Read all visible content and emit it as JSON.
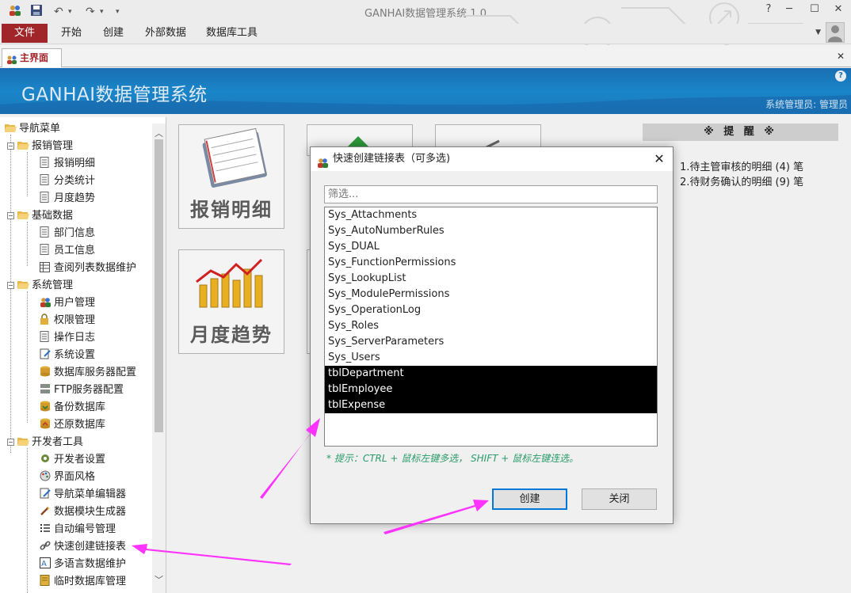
{
  "window": {
    "title": "GANHAI数据管理系统 1.0",
    "help": "?",
    "minimize": "─",
    "maximize": "☐",
    "close": "✕"
  },
  "quick_access": {
    "undo": "↶",
    "redo": "↷",
    "dropdown": "▾"
  },
  "menu": {
    "file": "文件",
    "items": [
      "开始",
      "创建",
      "外部数据",
      "数据库工具"
    ]
  },
  "tab": {
    "label": "主界面",
    "close": "✕"
  },
  "banner": {
    "app_name": "GANHAI数据管理系统",
    "user_label": "系统管理员: 管理员",
    "help": "?"
  },
  "nav": {
    "root": "导航菜单",
    "groups": [
      {
        "label": "报销管理",
        "items": [
          "报销明细",
          "分类统计",
          "月度趋势"
        ]
      },
      {
        "label": "基础数据",
        "items": [
          "部门信息",
          "员工信息",
          "查阅列表数据维护"
        ]
      },
      {
        "label": "系统管理",
        "items": [
          "用户管理",
          "权限管理",
          "操作日志",
          "系统设置",
          "数据库服务器配置",
          "FTP服务器配置",
          "备份数据库",
          "还原数据库"
        ]
      },
      {
        "label": "开发者工具",
        "items": [
          "开发者设置",
          "界面风格",
          "导航菜单编辑器",
          "数据模块生成器",
          "自动编号管理",
          "快速创建链接表",
          "多语言数据维护",
          "临时数据库管理"
        ]
      }
    ]
  },
  "tiles": {
    "expense_detail": "报销明细",
    "monthly_trend": "月度趋势"
  },
  "reminder": {
    "header": "※ 提 醒 ※",
    "lines": [
      "1.待主管审核的明细 (4) 笔",
      "2.待财务确认的明细 (9) 笔"
    ]
  },
  "dialog": {
    "title": "快速创建链接表（可多选)",
    "close": "✕",
    "filter_placeholder": "筛选...",
    "tables": [
      {
        "name": "Sys_Attachments",
        "selected": false
      },
      {
        "name": "Sys_AutoNumberRules",
        "selected": false
      },
      {
        "name": "Sys_DUAL",
        "selected": false
      },
      {
        "name": "Sys_FunctionPermissions",
        "selected": false
      },
      {
        "name": "Sys_LookupList",
        "selected": false
      },
      {
        "name": "Sys_ModulePermissions",
        "selected": false
      },
      {
        "name": "Sys_OperationLog",
        "selected": false
      },
      {
        "name": "Sys_Roles",
        "selected": false
      },
      {
        "name": "Sys_ServerParameters",
        "selected": false
      },
      {
        "name": "Sys_Users",
        "selected": false
      },
      {
        "name": "tblDepartment",
        "selected": true
      },
      {
        "name": "tblEmployee",
        "selected": true
      },
      {
        "name": "tblExpense",
        "selected": true
      }
    ],
    "hint": "* 提示：CTRL + 鼠标左键多选， SHIFT + 鼠标左键连选。",
    "create_button": "创建",
    "close_button": "关闭"
  },
  "colors": {
    "file_tab": "#a0262a",
    "banner": "#1a7bbf",
    "hint_text": "#2a9a6a",
    "arrow": "#ff33ff",
    "selection": "#000000"
  }
}
